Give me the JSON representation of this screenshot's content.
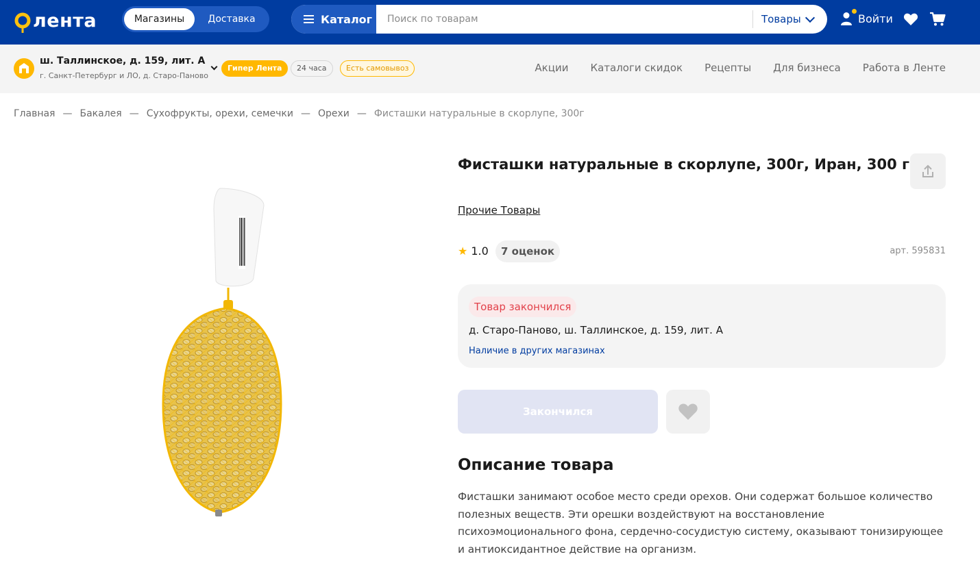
{
  "header": {
    "logo_text": "лента",
    "mode_toggle": {
      "stores": "Магазины",
      "delivery": "Доставка",
      "selected": "Магазины"
    },
    "catalog_label": "Каталог",
    "search_placeholder": "Поиск по товарам",
    "search_scope": "Товары",
    "login_label": "Войти",
    "icons": [
      "menu-icon",
      "chevron-down-icon",
      "user-icon",
      "heart-icon",
      "cart-icon"
    ]
  },
  "store_bar": {
    "address": "ш. Таллинское, д. 159, лит. А",
    "city": "г. Санкт-Петербург и ЛО, д. Старо-Паново",
    "badges": {
      "hyper": "Гипер Лента",
      "hours": "24 часа",
      "pickup": "Есть самовывоз"
    },
    "nav": [
      "Акции",
      "Каталоги скидок",
      "Рецепты",
      "Для бизнеса",
      "Работа в Ленте"
    ]
  },
  "breadcrumbs": [
    "Главная",
    "Бакалея",
    "Сухофрукты, орехи, семечки",
    "Орехи",
    "Фисташки натуральные в скорлупе, 300г"
  ],
  "product": {
    "title": "Фисташки натуральные в скорлупе, 300г, Иран, 300 г",
    "brand": "Прочие Товары",
    "rating": "1.0",
    "reviews": "7 оценок",
    "sku": "арт. 595831",
    "stock": {
      "status": "Товар закончился",
      "store_address": "д. Старо-Паново, ш. Таллинское, д. 159, лит. А",
      "other_stores_link": "Наличие в других магазинах"
    },
    "buy_button": "Закончился",
    "description_title": "Описание товара",
    "description": "Фисташки занимают особое место среди орехов. Они содержат большое количество полезных веществ. Эти орешки воздействуют на восстановление психоэмоционального фона, сердечно-сосудистую систему, оказывают тонизирующее и антиоксидантное действие на организм."
  },
  "colors": {
    "header_bg": "#003ca0",
    "accent_yellow": "#ffb800",
    "out_of_stock_red": "#e2414a",
    "disabled_button": "#e1e4f3"
  }
}
